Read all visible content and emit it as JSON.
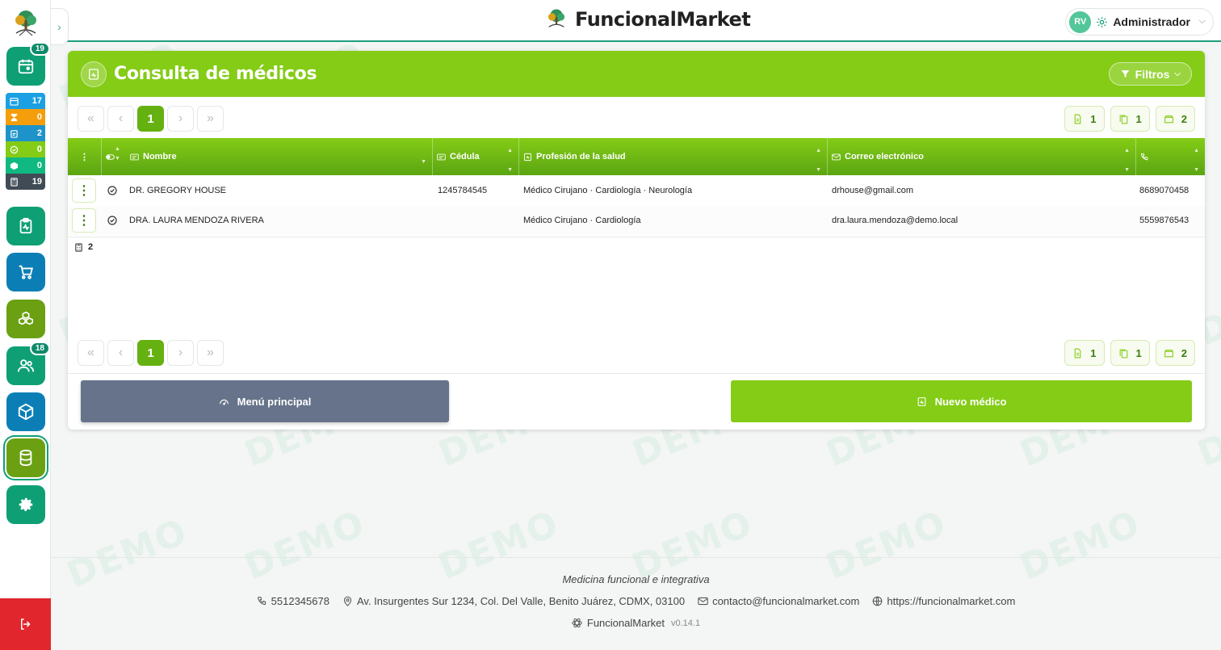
{
  "app": {
    "brand": "FuncionalMarket",
    "watermark": "DEMO"
  },
  "user": {
    "initials": "RV",
    "name": "Administrador"
  },
  "sidebar": {
    "items": [
      {
        "icon": "calendar-icon",
        "color": "#0e9f75",
        "badge": "19"
      },
      {
        "icon": "clipboard-pulse-icon",
        "color": "#0e9f75",
        "badge": ""
      },
      {
        "icon": "cart-icon",
        "color": "#0b7fb5",
        "badge": ""
      },
      {
        "icon": "boxes-icon",
        "color": "#6aa012",
        "badge": ""
      },
      {
        "icon": "users-icon",
        "color": "#0e9f75",
        "badge": "18"
      },
      {
        "icon": "package-icon",
        "color": "#0b7fb5",
        "badge": ""
      },
      {
        "icon": "database-icon",
        "color": "#6aa012",
        "badge": ""
      },
      {
        "icon": "gear-icon",
        "color": "#0e9f75",
        "badge": ""
      }
    ],
    "stats": [
      {
        "icon": "calendar-icon",
        "value": "17",
        "color": "#1ba0e3"
      },
      {
        "icon": "hourglass-icon",
        "value": "0",
        "color": "#f59e0b"
      },
      {
        "icon": "clipboard-icon",
        "value": "2",
        "color": "#1e93c9"
      },
      {
        "icon": "check-circle-icon",
        "value": "0",
        "color": "#84cc16"
      },
      {
        "icon": "box-icon",
        "value": "0",
        "color": "#10b981"
      },
      {
        "icon": "calculator-icon",
        "value": "19",
        "color": "#404b55"
      }
    ]
  },
  "page": {
    "title": "Consulta de médicos",
    "filters_label": "Filtros"
  },
  "pagination": {
    "first": "«",
    "prev": "‹",
    "current": "1",
    "next": "›",
    "last": "»",
    "counters": [
      {
        "icon": "file-icon",
        "value": "1"
      },
      {
        "icon": "copy-icon",
        "value": "1"
      },
      {
        "icon": "folder-icon",
        "value": "2"
      }
    ]
  },
  "table": {
    "headers": {
      "actions": "⋮",
      "name": "Nombre",
      "cedula": "Cédula",
      "profession": "Profesión de la salud",
      "email": "Correo electrónico",
      "phone": ""
    },
    "rows": [
      {
        "name": "DR. GREGORY HOUSE",
        "cedula": "1245784545",
        "profession": "Médico Cirujano · Cardiología · Neurología",
        "email": "drhouse@gmail.com",
        "phone": "8689070458"
      },
      {
        "name": "DRA. LAURA MENDOZA RIVERA",
        "cedula": "",
        "profession": "Médico Cirujano · Cardiología",
        "email": "dra.laura.mendoza@demo.local",
        "phone": "5559876543"
      }
    ],
    "total": "2"
  },
  "actions": {
    "main_menu": "Menú principal",
    "new_doctor": "Nuevo médico"
  },
  "footer": {
    "tagline": "Medicina funcional e integrativa",
    "phone": "5512345678",
    "address": "Av. Insurgentes Sur 1234, Col. Del Valle, Benito Juárez, CDMX, 03100",
    "email": "contacto@funcionalmarket.com",
    "website": "https://funcionalmarket.com",
    "brand": "FuncionalMarket",
    "version": "v0.14.1"
  }
}
